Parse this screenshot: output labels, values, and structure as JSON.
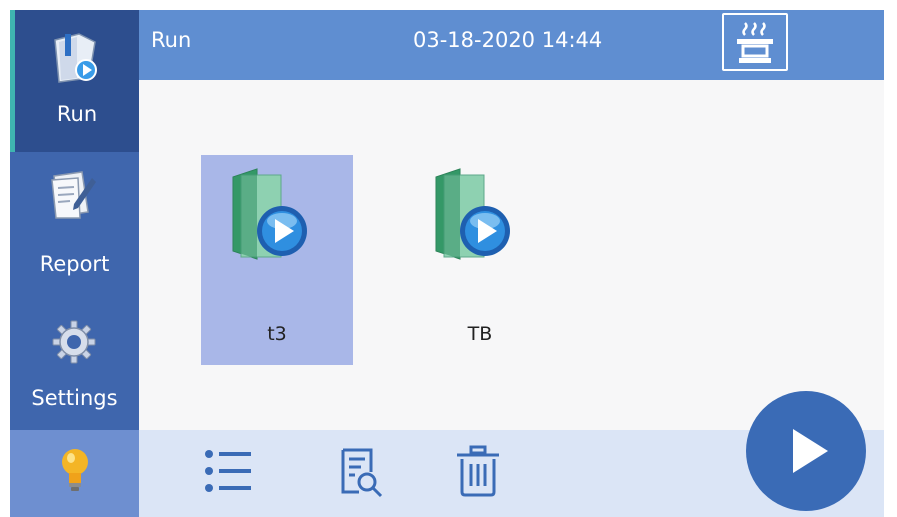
{
  "sidebar": {
    "items": [
      {
        "label": "Run",
        "icon": "run-book-icon"
      },
      {
        "label": "Report",
        "icon": "report-icon"
      },
      {
        "label": "Settings",
        "icon": "gear-icon"
      },
      {
        "label": "",
        "icon": "lightbulb-icon"
      }
    ]
  },
  "header": {
    "title": "Run",
    "datetime": "03-18-2020 14:44",
    "status_icon": "heater-icon"
  },
  "files": [
    {
      "name": "t3",
      "selected": true,
      "icon": "run-file-icon"
    },
    {
      "name": "TB",
      "selected": false,
      "icon": "run-file-icon"
    }
  ],
  "toolbar": {
    "icons": [
      "list-icon",
      "search-file-icon",
      "trash-icon",
      "play-icon"
    ]
  },
  "colors": {
    "sidebar": "#3f66ad",
    "sidebar_active": "#2d4e8e",
    "active_indicator": "#3fb5b0",
    "header": "#5f8ed1",
    "selection": "#a9b7e8",
    "toolbar": "#dbe5f6",
    "run_button": "#3a6bb6"
  }
}
